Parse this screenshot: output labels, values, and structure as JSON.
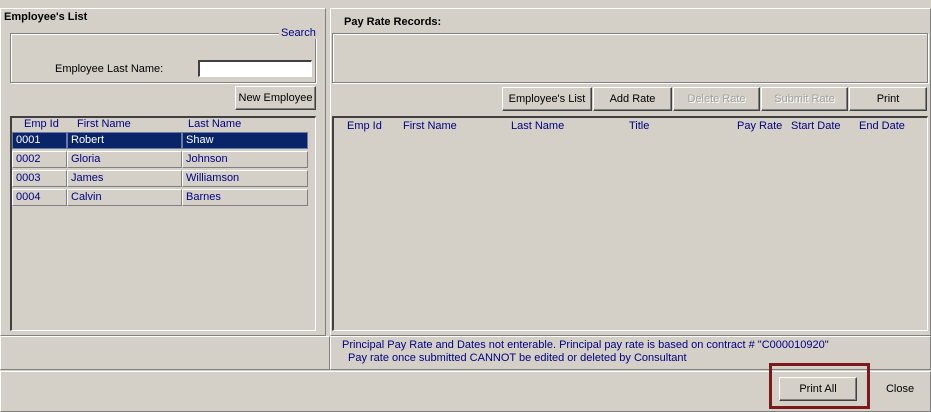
{
  "left_panel": {
    "title": "Employee's List",
    "search_group_label": "Search",
    "last_name_label": "Employee Last Name:",
    "last_name_value": "",
    "new_employee_button": "New Employee",
    "columns": [
      "Emp Id",
      "First Name",
      "Last Name"
    ],
    "rows": [
      {
        "emp_id": "0001",
        "first_name": "Robert",
        "last_name": "Shaw",
        "selected": true
      },
      {
        "emp_id": "0002",
        "first_name": "Gloria",
        "last_name": "Johnson",
        "selected": false
      },
      {
        "emp_id": "0003",
        "first_name": "James",
        "last_name": "Williamson",
        "selected": false
      },
      {
        "emp_id": "0004",
        "first_name": "Calvin",
        "last_name": "Barnes",
        "selected": false
      }
    ]
  },
  "right_panel": {
    "title": "Pay Rate Records:",
    "buttons": {
      "employees_list": "Employee's List",
      "add_rate": "Add Rate",
      "delete_rate": "Delete Rate",
      "submit_rate": "Submit Rate",
      "print": "Print"
    },
    "columns": [
      "Emp Id",
      "First Name",
      "Last Name",
      "Title",
      "Pay Rate",
      "Start Date",
      "End Date"
    ],
    "notes": {
      "line1": "Principal Pay Rate and Dates not enterable. Principal pay rate is based on contract # \"C000010920\"",
      "line2": "Pay rate once submitted CANNOT be edited or deleted by Consultant"
    }
  },
  "footer": {
    "print_all": "Print All",
    "close": "Close",
    "highlight_color": "#7b1a1a"
  },
  "colors": {
    "selection": "#0a246a",
    "text_accent": "#000080",
    "window_bg": "#d4d0c8"
  }
}
